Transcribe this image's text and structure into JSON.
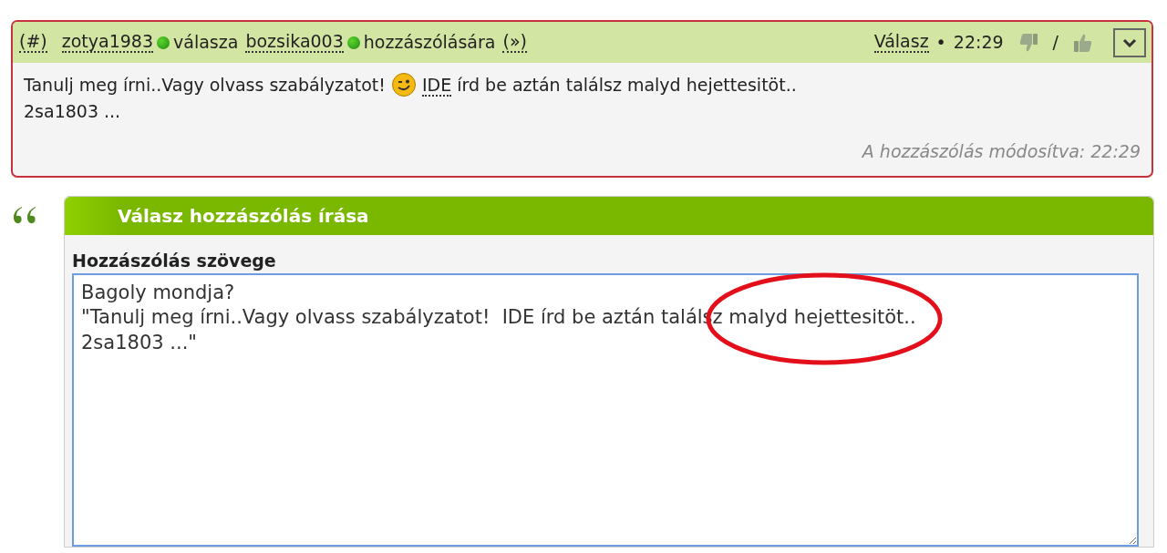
{
  "comment": {
    "header": {
      "permalink": "(#)",
      "author": {
        "name": "zotya1983",
        "online": true
      },
      "verb": "válasza",
      "target": {
        "name": "bozsika003",
        "online": true
      },
      "suffix": "hozzászólására",
      "jump": "(»)",
      "reply_link": "Válasz",
      "separator": "•",
      "time": "22:29",
      "vote_separator": "/"
    },
    "body": {
      "text_before": "Tanulj meg írni..Vagy olvass szabályzatot!",
      "link": "IDE",
      "text_after": "írd be aztán találsz malyd hejettesitöt..",
      "second_line": "2sa1803 ..."
    },
    "edited_note": "A hozzászólás módosítva: 22:29"
  },
  "reply_form": {
    "title": "Válasz hozzászólás írása",
    "field_label": "Hozzászólás szövege",
    "value": "Bagoly mondja?\n\"Tanulj meg írni..Vagy olvass szabályzatot!  IDE írd be aztán találsz malyd hejettesitöt..\n2sa1803 ...\""
  }
}
